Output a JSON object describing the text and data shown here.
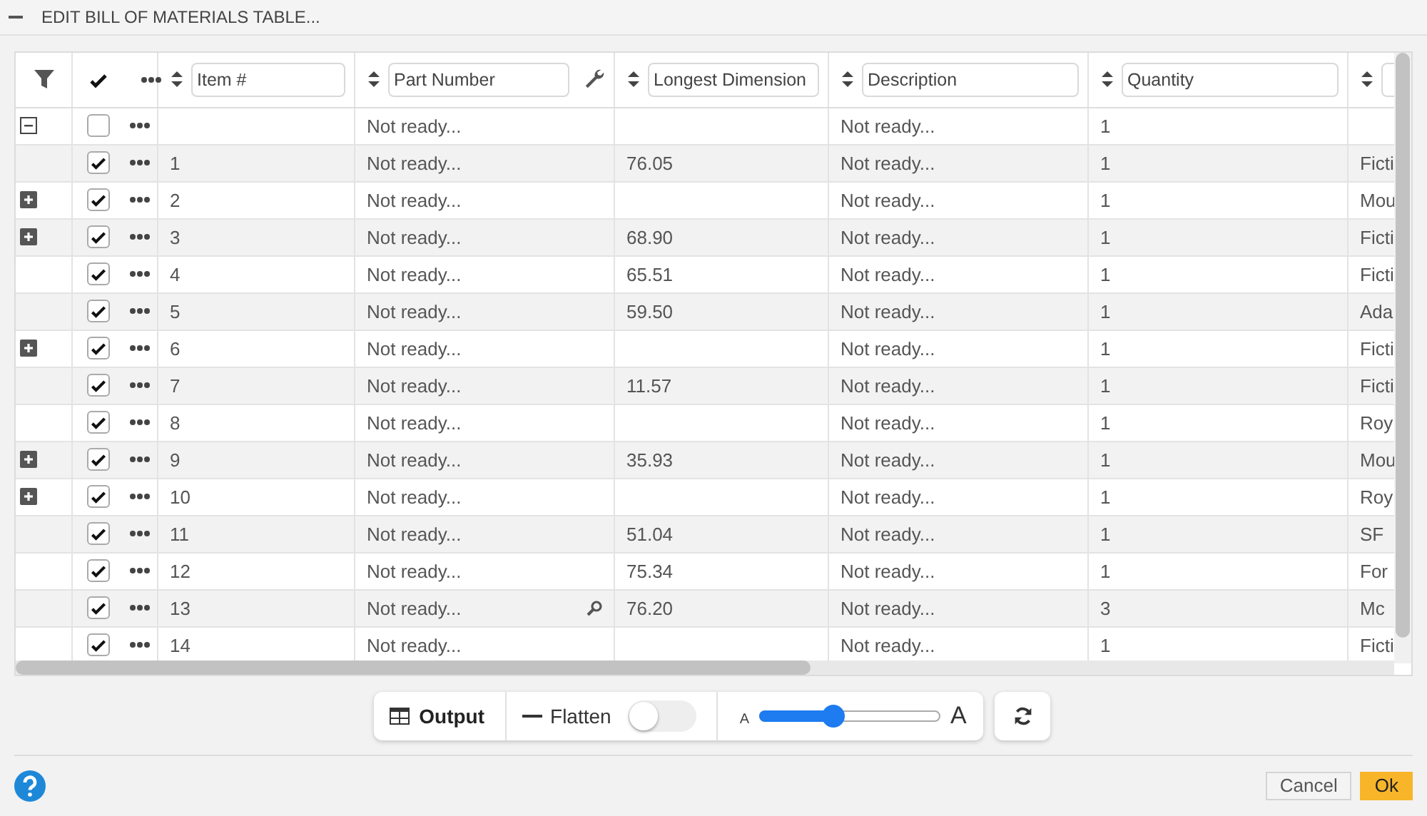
{
  "dialog": {
    "title": "EDIT BILL OF MATERIALS TABLE..."
  },
  "table": {
    "columns": [
      {
        "label": "Item #"
      },
      {
        "label": "Part Number",
        "wrench_icon": true
      },
      {
        "label": "Longest Dimension"
      },
      {
        "label": "Description"
      },
      {
        "label": "Quantity"
      }
    ],
    "rows": [
      {
        "expanded": true,
        "checked": false,
        "cells": [
          null,
          "Not ready...",
          null,
          "Not ready...",
          "1",
          null
        ]
      },
      {
        "checked": true,
        "cells": [
          "1",
          "Not ready...",
          "76.05",
          "Not ready...",
          "1",
          "Ficti"
        ]
      },
      {
        "expanded": false,
        "checked": true,
        "cells": [
          "2",
          "Not ready...",
          null,
          "Not ready...",
          "1",
          "Mou"
        ]
      },
      {
        "expanded": false,
        "checked": true,
        "cells": [
          "3",
          "Not ready...",
          "68.90",
          "Not ready...",
          "1",
          "Ficti"
        ]
      },
      {
        "checked": true,
        "cells": [
          "4",
          "Not ready...",
          "65.51",
          "Not ready...",
          "1",
          "Ficti"
        ]
      },
      {
        "checked": true,
        "cells": [
          "5",
          "Not ready...",
          "59.50",
          "Not ready...",
          "1",
          "Ada"
        ]
      },
      {
        "expanded": false,
        "checked": true,
        "cells": [
          "6",
          "Not ready...",
          null,
          "Not ready...",
          "1",
          "Ficti"
        ]
      },
      {
        "checked": true,
        "cells": [
          "7",
          "Not ready...",
          "11.57",
          "Not ready...",
          "1",
          "Ficti"
        ]
      },
      {
        "checked": true,
        "cells": [
          "8",
          "Not ready...",
          null,
          "Not ready...",
          "1",
          "Roy"
        ]
      },
      {
        "expanded": false,
        "checked": true,
        "cells": [
          "9",
          "Not ready...",
          "35.93",
          "Not ready...",
          "1",
          "Mou"
        ]
      },
      {
        "expanded": false,
        "checked": true,
        "cells": [
          "10",
          "Not ready...",
          null,
          "Not ready...",
          "1",
          "Roy"
        ]
      },
      {
        "checked": true,
        "cells": [
          "11",
          "Not ready...",
          "51.04",
          "Not ready...",
          "1",
          "SF"
        ]
      },
      {
        "checked": true,
        "cells": [
          "12",
          "Not ready...",
          "75.34",
          "Not ready...",
          "1",
          "For"
        ]
      },
      {
        "checked": true,
        "lookup_icon": true,
        "cells": [
          "13",
          "Not ready...",
          "76.20",
          "Not ready...",
          "3",
          "Mc"
        ]
      },
      {
        "checked": true,
        "cells": [
          "14",
          "Not ready...",
          null,
          "Not ready...",
          "1",
          "Ficti"
        ]
      }
    ]
  },
  "toolbar": {
    "output": {
      "label": "Output"
    },
    "flatten": {
      "label": "Flatten",
      "on": false
    },
    "text_size": {
      "small_label": "A",
      "large_label": "A",
      "level": 0.41
    }
  },
  "footer": {
    "buttons": [
      {
        "label": "Cancel",
        "kind": "secondary"
      },
      {
        "label": "Ok",
        "kind": "primary"
      }
    ]
  }
}
